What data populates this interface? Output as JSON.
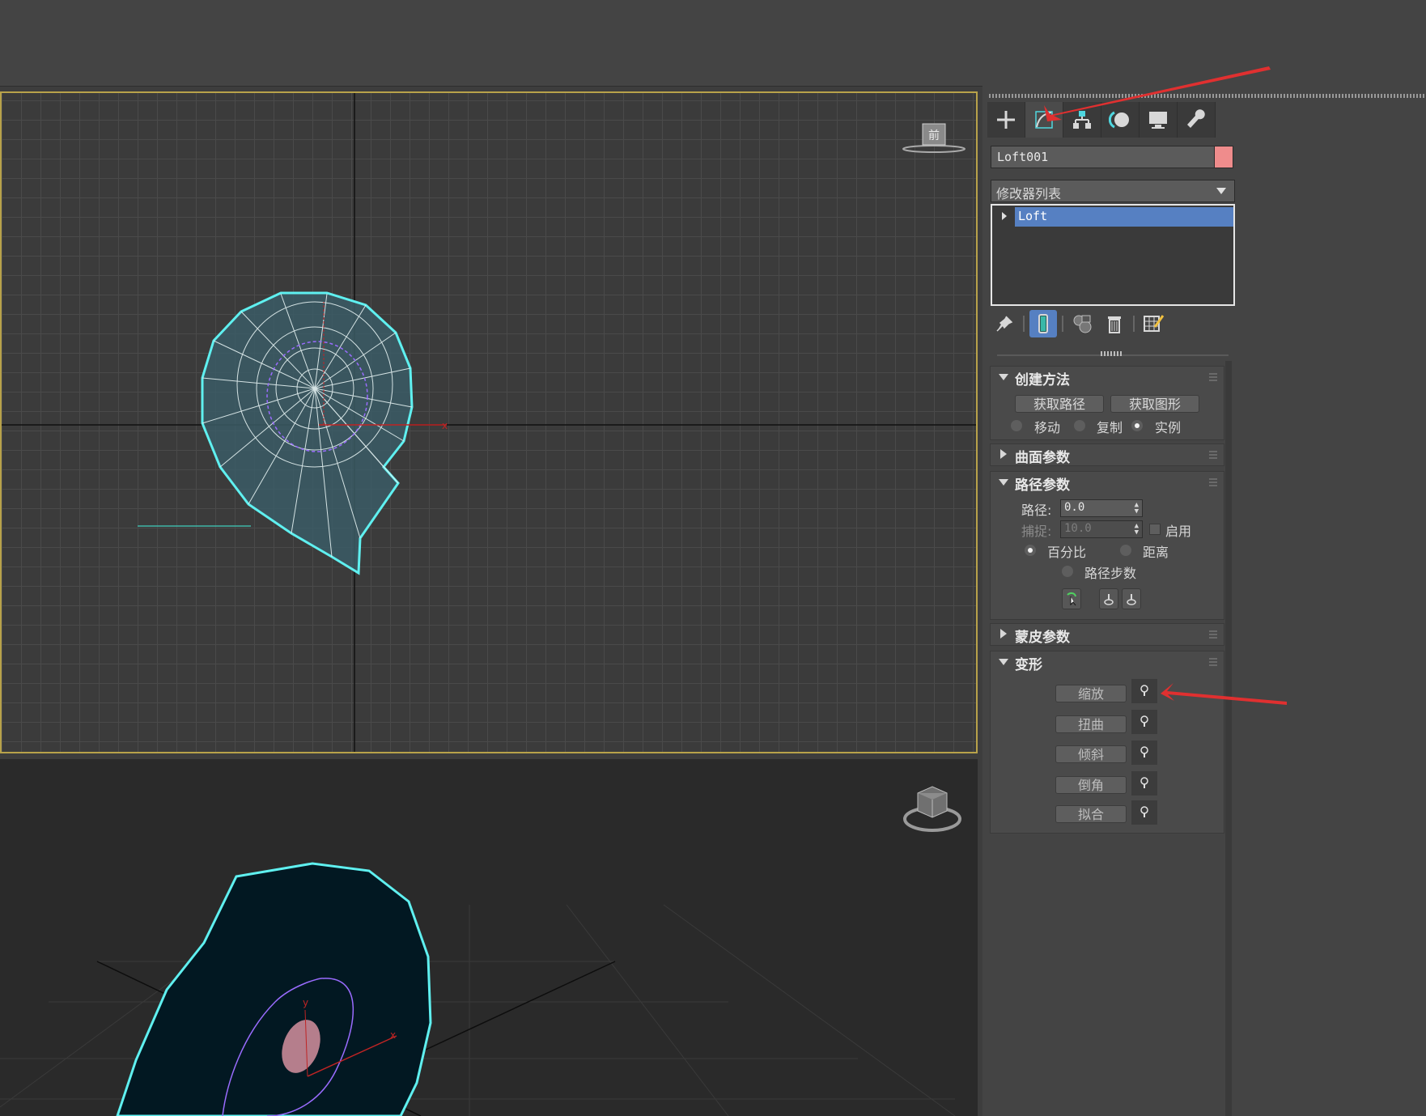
{
  "panel": {
    "tabs": [
      {
        "name": "create-tab",
        "icon": "plus-icon"
      },
      {
        "name": "modify-tab",
        "icon": "modify-curve-icon"
      },
      {
        "name": "hierarchy-tab",
        "icon": "hierarchy-icon"
      },
      {
        "name": "motion-tab",
        "icon": "motion-icon"
      },
      {
        "name": "display-tab",
        "icon": "monitor-icon"
      },
      {
        "name": "utilities-tab",
        "icon": "wrench-icon"
      }
    ],
    "object_name": "Loft001",
    "object_color": "#ef8c8c",
    "modifier_list": "修改器列表",
    "stack_item": "Loft"
  },
  "creation_method": {
    "title": "创建方法",
    "get_path": "获取路径",
    "get_shape": "获取图形",
    "move": "移动",
    "copy": "复制",
    "instance": "实例",
    "selected": "instance"
  },
  "surface_params": {
    "title": "曲面参数"
  },
  "path_params": {
    "title": "路径参数",
    "path_label": "路径:",
    "path_value": "0.0",
    "snap_label": "捕捉:",
    "snap_value": "10.0",
    "enable_label": "启用",
    "percentage": "百分比",
    "distance": "距离",
    "path_steps": "路径步数",
    "selected": "percentage"
  },
  "skin_params": {
    "title": "蒙皮参数"
  },
  "deformations": {
    "title": "变形",
    "items": [
      "缩放",
      "扭曲",
      "倾斜",
      "倒角",
      "拟合"
    ]
  },
  "viewports": {
    "front_cube_label": "前"
  },
  "colors": {
    "accent_blue": "#5680c2",
    "viewport_border": "#b8a24a",
    "selection_cyan": "#5ff0f0",
    "annotation_red": "#e03030"
  }
}
